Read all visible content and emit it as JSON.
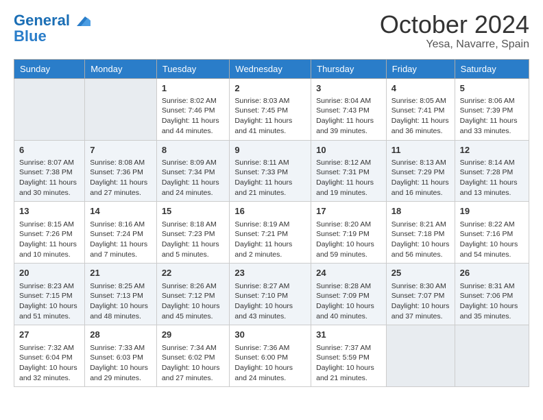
{
  "logo": {
    "line1": "General",
    "line2": "Blue"
  },
  "title": "October 2024",
  "subtitle": "Yesa, Navarre, Spain",
  "headers": [
    "Sunday",
    "Monday",
    "Tuesday",
    "Wednesday",
    "Thursday",
    "Friday",
    "Saturday"
  ],
  "weeks": [
    [
      {
        "day": "",
        "info": ""
      },
      {
        "day": "",
        "info": ""
      },
      {
        "day": "1",
        "info": "Sunrise: 8:02 AM\nSunset: 7:46 PM\nDaylight: 11 hours and 44 minutes."
      },
      {
        "day": "2",
        "info": "Sunrise: 8:03 AM\nSunset: 7:45 PM\nDaylight: 11 hours and 41 minutes."
      },
      {
        "day": "3",
        "info": "Sunrise: 8:04 AM\nSunset: 7:43 PM\nDaylight: 11 hours and 39 minutes."
      },
      {
        "day": "4",
        "info": "Sunrise: 8:05 AM\nSunset: 7:41 PM\nDaylight: 11 hours and 36 minutes."
      },
      {
        "day": "5",
        "info": "Sunrise: 8:06 AM\nSunset: 7:39 PM\nDaylight: 11 hours and 33 minutes."
      }
    ],
    [
      {
        "day": "6",
        "info": "Sunrise: 8:07 AM\nSunset: 7:38 PM\nDaylight: 11 hours and 30 minutes."
      },
      {
        "day": "7",
        "info": "Sunrise: 8:08 AM\nSunset: 7:36 PM\nDaylight: 11 hours and 27 minutes."
      },
      {
        "day": "8",
        "info": "Sunrise: 8:09 AM\nSunset: 7:34 PM\nDaylight: 11 hours and 24 minutes."
      },
      {
        "day": "9",
        "info": "Sunrise: 8:11 AM\nSunset: 7:33 PM\nDaylight: 11 hours and 21 minutes."
      },
      {
        "day": "10",
        "info": "Sunrise: 8:12 AM\nSunset: 7:31 PM\nDaylight: 11 hours and 19 minutes."
      },
      {
        "day": "11",
        "info": "Sunrise: 8:13 AM\nSunset: 7:29 PM\nDaylight: 11 hours and 16 minutes."
      },
      {
        "day": "12",
        "info": "Sunrise: 8:14 AM\nSunset: 7:28 PM\nDaylight: 11 hours and 13 minutes."
      }
    ],
    [
      {
        "day": "13",
        "info": "Sunrise: 8:15 AM\nSunset: 7:26 PM\nDaylight: 11 hours and 10 minutes."
      },
      {
        "day": "14",
        "info": "Sunrise: 8:16 AM\nSunset: 7:24 PM\nDaylight: 11 hours and 7 minutes."
      },
      {
        "day": "15",
        "info": "Sunrise: 8:18 AM\nSunset: 7:23 PM\nDaylight: 11 hours and 5 minutes."
      },
      {
        "day": "16",
        "info": "Sunrise: 8:19 AM\nSunset: 7:21 PM\nDaylight: 11 hours and 2 minutes."
      },
      {
        "day": "17",
        "info": "Sunrise: 8:20 AM\nSunset: 7:19 PM\nDaylight: 10 hours and 59 minutes."
      },
      {
        "day": "18",
        "info": "Sunrise: 8:21 AM\nSunset: 7:18 PM\nDaylight: 10 hours and 56 minutes."
      },
      {
        "day": "19",
        "info": "Sunrise: 8:22 AM\nSunset: 7:16 PM\nDaylight: 10 hours and 54 minutes."
      }
    ],
    [
      {
        "day": "20",
        "info": "Sunrise: 8:23 AM\nSunset: 7:15 PM\nDaylight: 10 hours and 51 minutes."
      },
      {
        "day": "21",
        "info": "Sunrise: 8:25 AM\nSunset: 7:13 PM\nDaylight: 10 hours and 48 minutes."
      },
      {
        "day": "22",
        "info": "Sunrise: 8:26 AM\nSunset: 7:12 PM\nDaylight: 10 hours and 45 minutes."
      },
      {
        "day": "23",
        "info": "Sunrise: 8:27 AM\nSunset: 7:10 PM\nDaylight: 10 hours and 43 minutes."
      },
      {
        "day": "24",
        "info": "Sunrise: 8:28 AM\nSunset: 7:09 PM\nDaylight: 10 hours and 40 minutes."
      },
      {
        "day": "25",
        "info": "Sunrise: 8:30 AM\nSunset: 7:07 PM\nDaylight: 10 hours and 37 minutes."
      },
      {
        "day": "26",
        "info": "Sunrise: 8:31 AM\nSunset: 7:06 PM\nDaylight: 10 hours and 35 minutes."
      }
    ],
    [
      {
        "day": "27",
        "info": "Sunrise: 7:32 AM\nSunset: 6:04 PM\nDaylight: 10 hours and 32 minutes."
      },
      {
        "day": "28",
        "info": "Sunrise: 7:33 AM\nSunset: 6:03 PM\nDaylight: 10 hours and 29 minutes."
      },
      {
        "day": "29",
        "info": "Sunrise: 7:34 AM\nSunset: 6:02 PM\nDaylight: 10 hours and 27 minutes."
      },
      {
        "day": "30",
        "info": "Sunrise: 7:36 AM\nSunset: 6:00 PM\nDaylight: 10 hours and 24 minutes."
      },
      {
        "day": "31",
        "info": "Sunrise: 7:37 AM\nSunset: 5:59 PM\nDaylight: 10 hours and 21 minutes."
      },
      {
        "day": "",
        "info": ""
      },
      {
        "day": "",
        "info": ""
      }
    ]
  ]
}
